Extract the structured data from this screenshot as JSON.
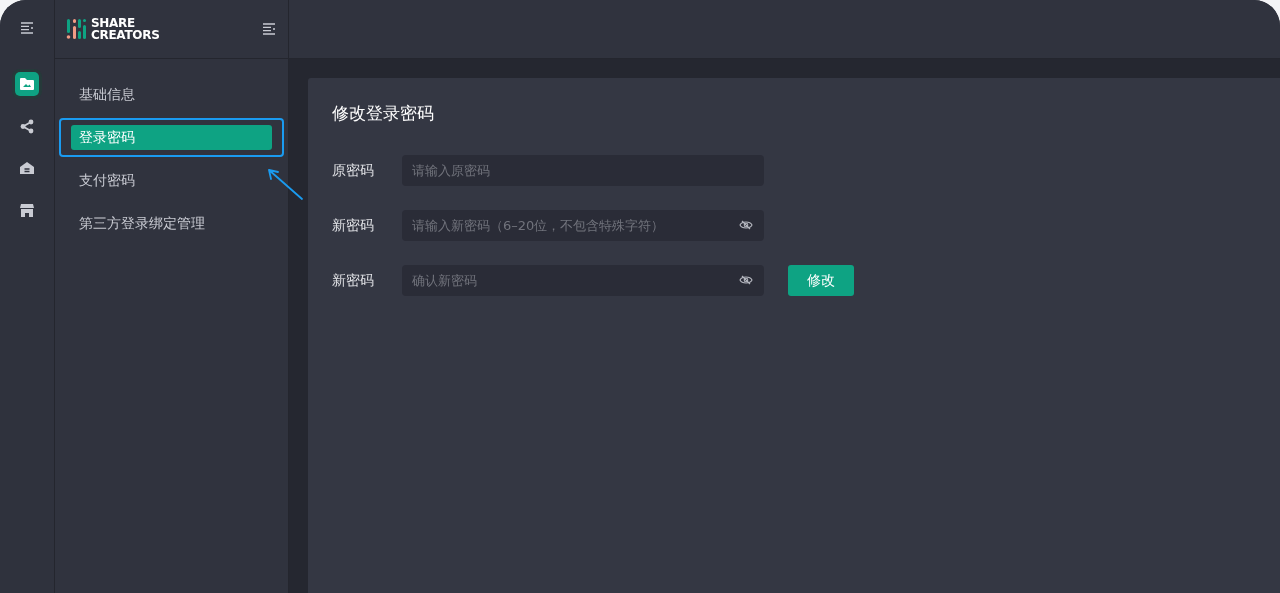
{
  "logo": {
    "lines": [
      "SHARE",
      "CREATORS"
    ]
  },
  "rail": [
    {
      "kind": "folder",
      "selected": true
    },
    {
      "kind": "share",
      "selected": false
    },
    {
      "kind": "home",
      "selected": false
    },
    {
      "kind": "store",
      "selected": false
    }
  ],
  "menu": [
    {
      "label": "基础信息",
      "selected": false,
      "highlighted": false
    },
    {
      "label": "登录密码",
      "selected": true,
      "highlighted": true
    },
    {
      "label": "支付密码",
      "selected": false,
      "highlighted": false
    },
    {
      "label": "第三方登录绑定管理",
      "selected": false,
      "highlighted": false
    }
  ],
  "form": {
    "title": "修改登录密码",
    "fields": [
      {
        "label": "原密码",
        "placeholder": "请输入原密码",
        "eye": false
      },
      {
        "label": "新密码",
        "placeholder": "请输入新密码（6–20位，不包含特殊字符）",
        "eye": true
      },
      {
        "label": "新密码",
        "placeholder": "确认新密码",
        "eye": true
      }
    ],
    "submit": "修改"
  }
}
